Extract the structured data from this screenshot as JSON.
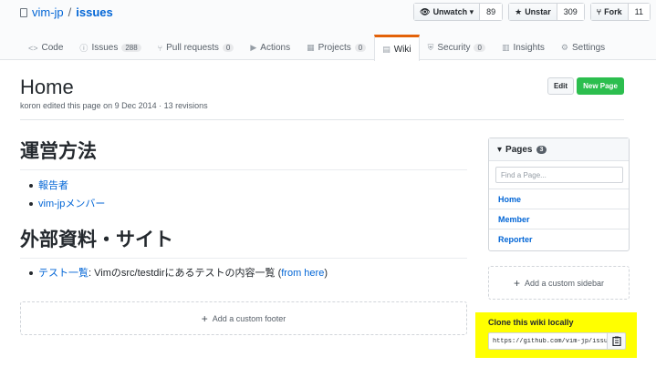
{
  "repo": {
    "owner": "vim-jp",
    "separator": "/",
    "name": "issues"
  },
  "actions": {
    "watch": {
      "label": "Unwatch ▾",
      "count": "89"
    },
    "star": {
      "label": "Unstar",
      "count": "309"
    },
    "fork": {
      "label": "Fork",
      "count": "11"
    }
  },
  "tabs": [
    {
      "label": "Code",
      "icon": "<>",
      "count": ""
    },
    {
      "label": "Issues",
      "icon": "ⓘ",
      "count": "288"
    },
    {
      "label": "Pull requests",
      "icon": "⑂",
      "count": "0"
    },
    {
      "label": "Actions",
      "icon": "▶",
      "count": ""
    },
    {
      "label": "Projects",
      "icon": "▦",
      "count": "0"
    },
    {
      "label": "Wiki",
      "icon": "▤",
      "count": ""
    },
    {
      "label": "Security",
      "icon": "⛨",
      "count": "0"
    },
    {
      "label": "Insights",
      "icon": "▥",
      "count": ""
    },
    {
      "label": "Settings",
      "icon": "⚙",
      "count": ""
    }
  ],
  "page": {
    "title": "Home",
    "meta": "koron edited this page on 9 Dec 2014 · 13 revisions",
    "edit_label": "Edit",
    "new_label": "New Page"
  },
  "content": {
    "h1": "運営方法",
    "list1": [
      "報告者",
      "vim-jpメンバー"
    ],
    "h2": "外部資料・サイト",
    "list2_link": "テスト一覧",
    "list2_text": ": Vimのsrc/testdirにあるテストの内容一覧 (",
    "list2_paren_link": "from here",
    "list2_close": ")"
  },
  "footer": {
    "add_label": "Add a custom footer"
  },
  "sidebar": {
    "pages_label": "Pages",
    "pages_count": "3",
    "find_placeholder": "Find a Page...",
    "pages": [
      "Home",
      "Member",
      "Reporter"
    ],
    "add_label": "Add a custom sidebar"
  },
  "clone": {
    "label": "Clone this wiki locally",
    "url": "https://github.com/vim-jp/issues.wiki.git"
  }
}
